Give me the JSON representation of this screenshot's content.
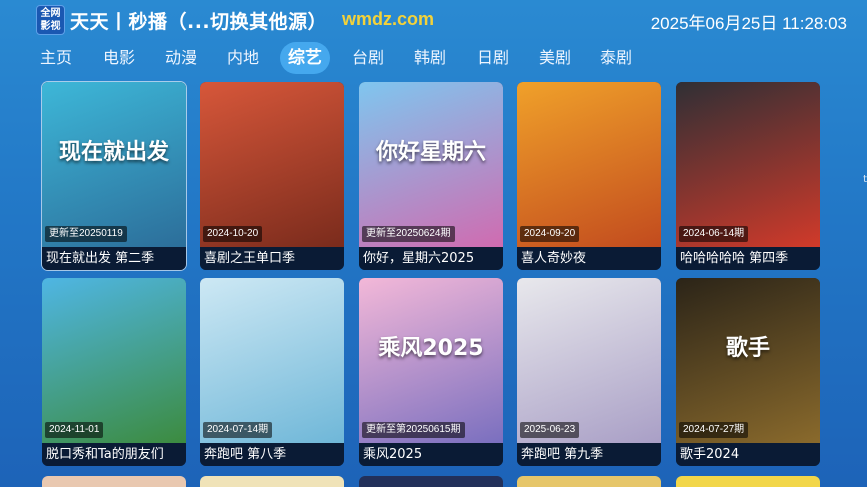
{
  "header": {
    "logo_line1": "全网",
    "logo_line2": "影视",
    "title": "天天丨秒播（...切换其他源）",
    "site": "wmdz.com",
    "datetime": "2025年06月25日 11:28:03"
  },
  "tabs": [
    {
      "label": "主页"
    },
    {
      "label": "电影"
    },
    {
      "label": "动漫"
    },
    {
      "label": "内地"
    },
    {
      "label": "综艺"
    },
    {
      "label": "台剧"
    },
    {
      "label": "韩剧"
    },
    {
      "label": "日剧"
    },
    {
      "label": "美剧"
    },
    {
      "label": "泰剧"
    }
  ],
  "active_tab": "综艺",
  "items": [
    {
      "title": "现在就出发 第二季",
      "badge": "更新至20250119",
      "poster_text": "现在就出发",
      "colors": [
        "#3db7d8",
        "#2c6e9a"
      ]
    },
    {
      "title": "喜剧之王单口季",
      "badge": "2024-10-20",
      "poster_text": "",
      "colors": [
        "#d7573a",
        "#7a2b1c"
      ]
    },
    {
      "title": "你好，星期六2025",
      "badge": "更新至20250624期",
      "poster_text": "你好星期六",
      "colors": [
        "#7fc6ef",
        "#d06bb0"
      ]
    },
    {
      "title": "喜人奇妙夜",
      "badge": "2024-09-20",
      "poster_text": "",
      "colors": [
        "#f0a12a",
        "#c24b1e"
      ]
    },
    {
      "title": "哈哈哈哈哈 第四季",
      "badge": "2024-06-14期",
      "poster_text": "",
      "colors": [
        "#2f2f35",
        "#d13a2a"
      ]
    },
    {
      "title": "脱口秀和Ta的朋友们",
      "badge": "2024-11-01",
      "poster_text": "",
      "colors": [
        "#4fb6e4",
        "#3c8b3f"
      ]
    },
    {
      "title": "奔跑吧 第八季",
      "badge": "2024-07-14期",
      "poster_text": "",
      "colors": [
        "#cde8f4",
        "#6fb7d8"
      ]
    },
    {
      "title": "乘风2025",
      "badge": "更新至第20250615期",
      "poster_text": "乘风2025",
      "colors": [
        "#f3b8d8",
        "#7a6fbf"
      ]
    },
    {
      "title": "奔跑吧 第九季",
      "badge": "2025-06-23",
      "poster_text": "",
      "colors": [
        "#e8e8ec",
        "#a99fc6"
      ]
    },
    {
      "title": "歌手2024",
      "badge": "2024-07-27期",
      "poster_text": "歌手",
      "colors": [
        "#2b2418",
        "#8a6a2c"
      ]
    }
  ],
  "next_row_colors": [
    "#e9c8b0",
    "#f0e3b8",
    "#22305a",
    "#e6c66a",
    "#f2d64a"
  ],
  "edge_marker": "t"
}
